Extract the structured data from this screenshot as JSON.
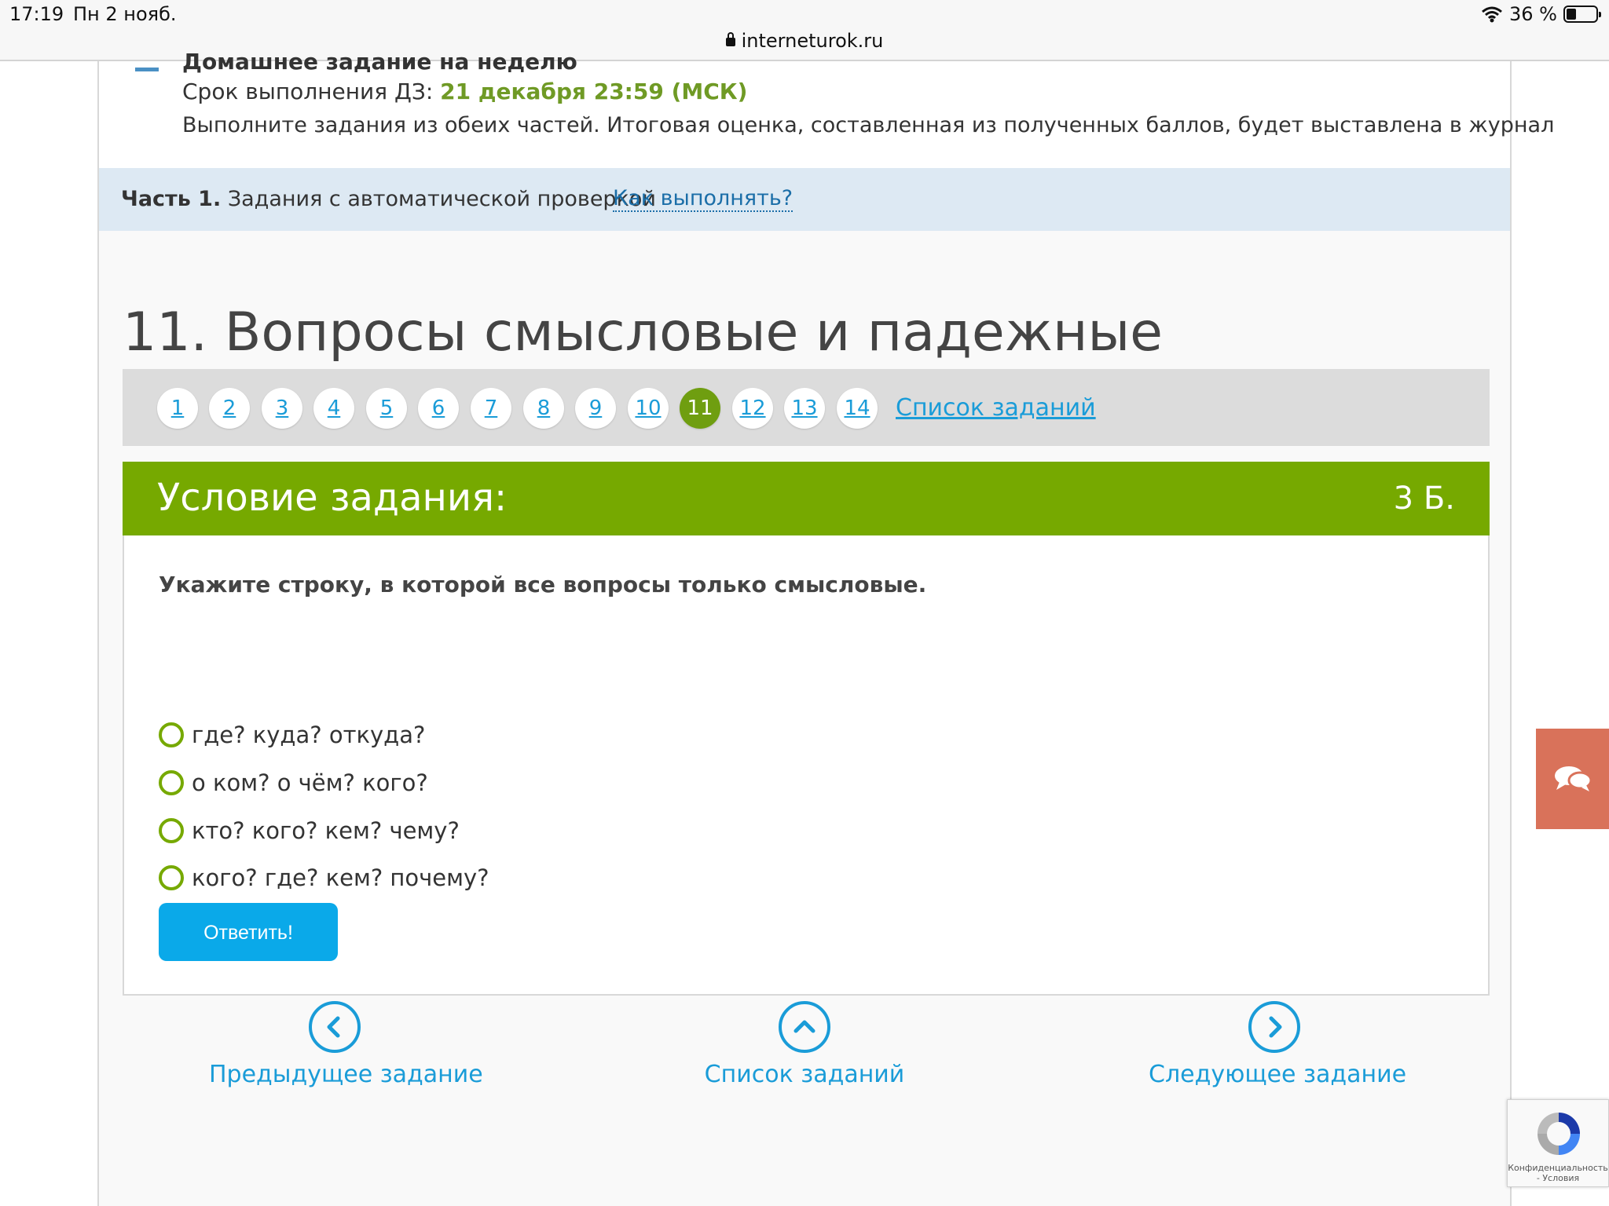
{
  "status_bar": {
    "time": "17:19",
    "date": "Пн 2 нояб.",
    "url": "interneturok.ru",
    "battery": "36 %"
  },
  "homework": {
    "title": "Домашнее задание на неделю",
    "deadline_label": "Срок выполнения ДЗ:",
    "deadline_value": "21 декабря 23:59 (МСК)",
    "description": "Выполните задания из обеих частей. Итоговая оценка, составленная из полученных баллов, будет выставлена в журнал"
  },
  "part": {
    "label_bold": "Часть 1.",
    "label_text": "Задания с автоматической проверкой",
    "help_link": "Как выполнять?"
  },
  "task_title": "11. Вопросы смысловые и падежные",
  "pager": {
    "items": [
      "1",
      "2",
      "3",
      "4",
      "5",
      "6",
      "7",
      "8",
      "9",
      "10",
      "11",
      "12",
      "13",
      "14"
    ],
    "active": "11",
    "list_link": "Список заданий"
  },
  "condition": {
    "title": "Условие задания:",
    "score": "3 Б.",
    "question": "Укажите строку, в которой все вопросы только смысловые.",
    "options": [
      "где? куда? откуда?",
      "о ком? о чём? кого?",
      "кто? кого? кем? чему?",
      "кого? где? кем? почему?"
    ],
    "answer_button": "Ответить!"
  },
  "navigation": {
    "prev": "Предыдущее задание",
    "list": "Список заданий",
    "next": "Следующее задание"
  },
  "recaptcha": {
    "text": "Конфиденциальность - Условия"
  },
  "colors": {
    "green": "#76a900",
    "link_blue": "#1a9cd8",
    "button_blue": "#0aa9e9",
    "chat_orange": "#d9725a"
  }
}
